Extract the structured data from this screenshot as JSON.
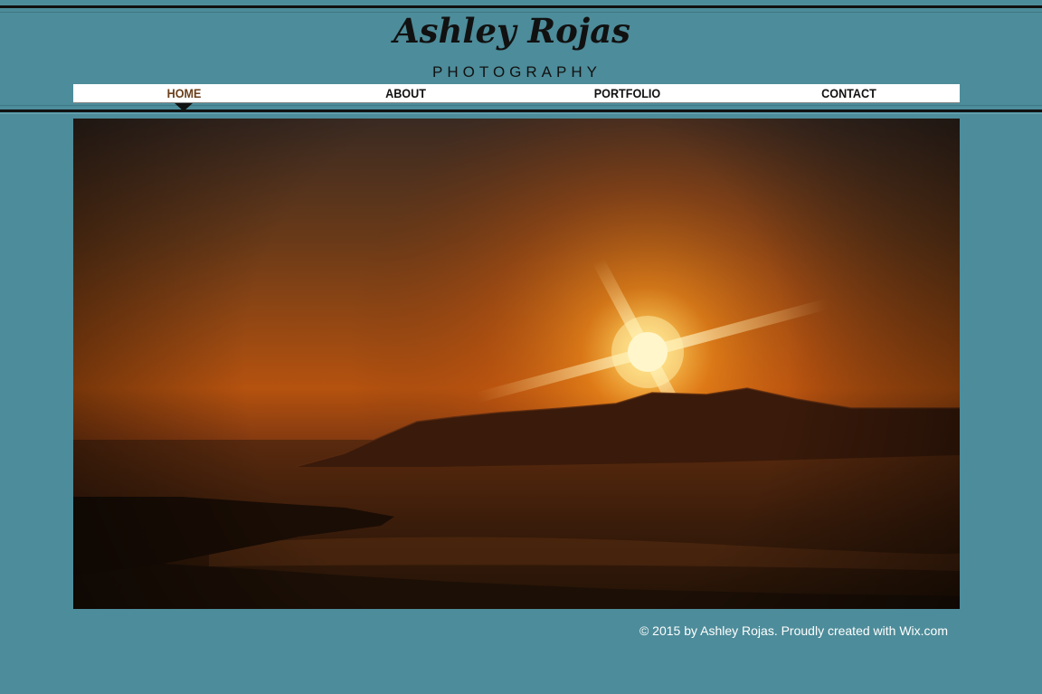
{
  "site": {
    "title": "Ashley Rojas",
    "subtitle": "PHOTOGRAPHY"
  },
  "nav": {
    "items": [
      {
        "label": "HOME",
        "active": true
      },
      {
        "label": "ABOUT",
        "active": false
      },
      {
        "label": "PORTFOLIO",
        "active": false
      },
      {
        "label": "CONTACT",
        "active": false
      }
    ]
  },
  "hero": {
    "image": "sunset-over-sea-photo"
  },
  "footer": {
    "text": "© 2015 by Ashley Rojas. Proudly created with Wix.com"
  },
  "colors": {
    "background": "#4d8c9a",
    "nav_background": "#ffffff",
    "active_nav": "#6b3f1a",
    "footer_text": "#ffffff"
  }
}
